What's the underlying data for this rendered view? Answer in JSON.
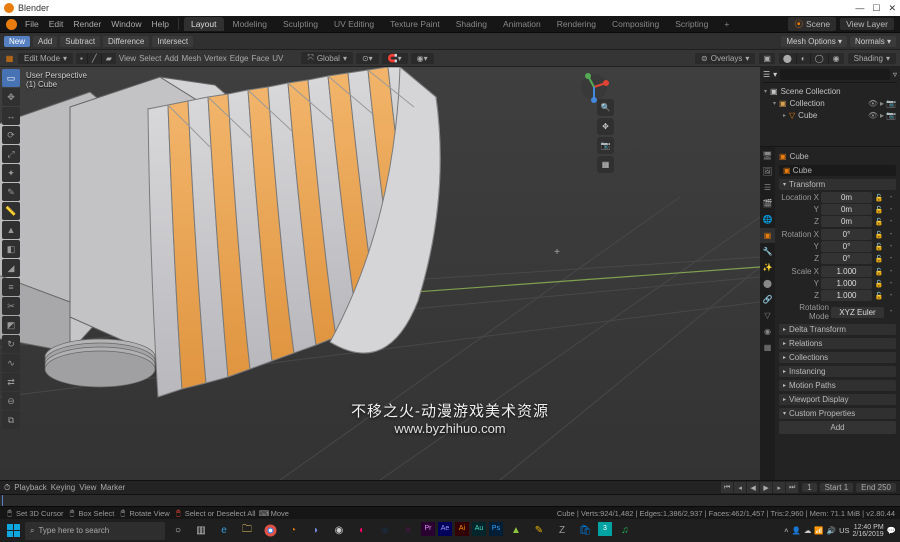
{
  "window": {
    "title": "Blender",
    "controls": {
      "min": "—",
      "max": "☐",
      "close": "✕"
    }
  },
  "menubar": {
    "menus": [
      "File",
      "Edit",
      "Render",
      "Window",
      "Help"
    ],
    "tabs": [
      "Layout",
      "Modeling",
      "Sculpting",
      "UV Editing",
      "Texture Paint",
      "Shading",
      "Animation",
      "Rendering",
      "Compositing",
      "Scripting"
    ],
    "active_tab": "Layout",
    "scene_label": "Scene",
    "viewlayer_label": "View Layer"
  },
  "workspace_header": {
    "buttons": [
      "New",
      "Add",
      "Subtract",
      "Difference",
      "Intersect"
    ]
  },
  "viewport_header": {
    "editor_type": "3D Viewport",
    "mode": "Edit Mode",
    "menus": [
      "View",
      "Select",
      "Add",
      "Mesh",
      "Vertex",
      "Edge",
      "Face",
      "UV"
    ],
    "orientation": "Global",
    "overlays_label": "Overlays",
    "shading_label": "Shading"
  },
  "viewport_info": {
    "line1": "User Perspective",
    "line2": "(1) Cube"
  },
  "outliner": {
    "root": "Scene Collection",
    "items": [
      {
        "name": "Collection",
        "icon": "collection"
      },
      {
        "name": "Cube",
        "icon": "mesh"
      }
    ],
    "options_label": "Mesh Options",
    "normals_label": "Normals"
  },
  "properties": {
    "object_name": "Cube",
    "object_field": "Cube",
    "panels": {
      "transform": "Transform",
      "delta": "Delta Transform",
      "relations": "Relations",
      "collections": "Collections",
      "instancing": "Instancing",
      "motion": "Motion Paths",
      "viewport": "Viewport Display",
      "custom": "Custom Properties"
    },
    "transform": {
      "location": {
        "label": "Location X",
        "y": "Y",
        "z": "Z",
        "x_val": "0m",
        "y_val": "0m",
        "z_val": "0m"
      },
      "rotation": {
        "label": "Rotation X",
        "y": "Y",
        "z": "Z",
        "x_val": "0°",
        "y_val": "0°",
        "z_val": "0°"
      },
      "scale": {
        "label": "Scale X",
        "y": "Y",
        "z": "Z",
        "x_val": "1.000",
        "y_val": "1.000",
        "z_val": "1.000"
      },
      "rotation_mode_label": "Rotation Mode",
      "rotation_mode": "XYZ Euler"
    },
    "add_button": "Add"
  },
  "timeline": {
    "menus": [
      "Playback",
      "Keying",
      "View",
      "Marker"
    ],
    "current": "1",
    "start_label": "Start",
    "start": "1",
    "end_label": "End",
    "end": "250"
  },
  "statusbar": {
    "cursor": "Set 3D Cursor",
    "box": "Box Select",
    "rotate": "Rotate View",
    "select_deselect": "Select or Deselect All",
    "move": "Move",
    "stats": "Cube | Verts:924/1,482 | Edges:1,386/2,937 | Faces:462/1,457 | Tris:2,960 | Mem: 71.1 MiB | v2.80.44"
  },
  "taskbar": {
    "search_placeholder": "Type here to search",
    "clock_time": "12:40 PM",
    "clock_date": "2/16/2019"
  },
  "watermark": {
    "cn": "不移之火-动漫游戏美术资源",
    "url": "www.byzhihuo.com"
  }
}
